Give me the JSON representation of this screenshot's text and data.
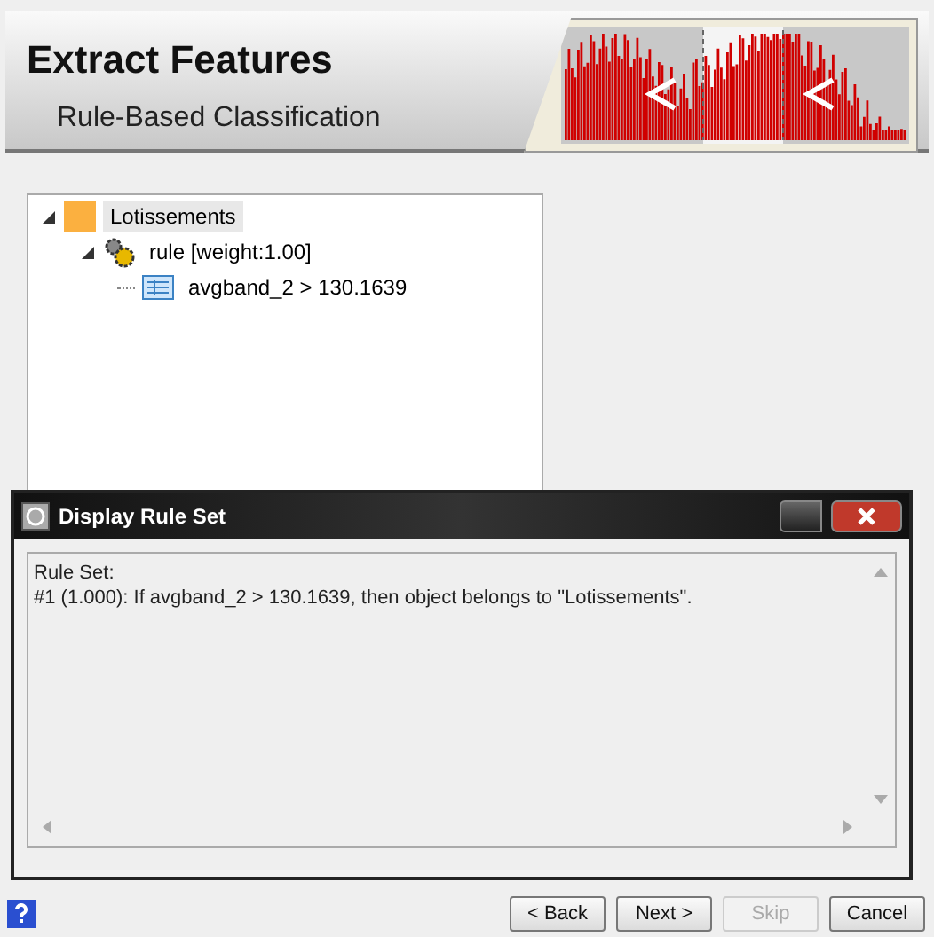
{
  "header": {
    "title": "Extract Features",
    "subtitle": "Rule-Based Classification"
  },
  "tree": [
    {
      "label": "Lotissements",
      "kind": "class",
      "selected": true,
      "expanded": true,
      "children": [
        {
          "label": "rule [weight:1.00]",
          "kind": "rule",
          "selected": false,
          "expanded": true,
          "children": [
            {
              "label": "avgband_2 > 130.1639",
              "kind": "condition",
              "selected": false
            }
          ]
        }
      ]
    }
  ],
  "dialog": {
    "title": "Display Rule Set",
    "lines": [
      "Rule Set:",
      "#1 (1.000): If avgband_2 > 130.1639, then object belongs to \"Lotissements\"."
    ]
  },
  "buttons": [
    {
      "label": "< Back",
      "disabled": false
    },
    {
      "label": "Next >",
      "disabled": false
    },
    {
      "label": "Skip",
      "disabled": true
    },
    {
      "label": "Cancel",
      "disabled": false
    }
  ]
}
